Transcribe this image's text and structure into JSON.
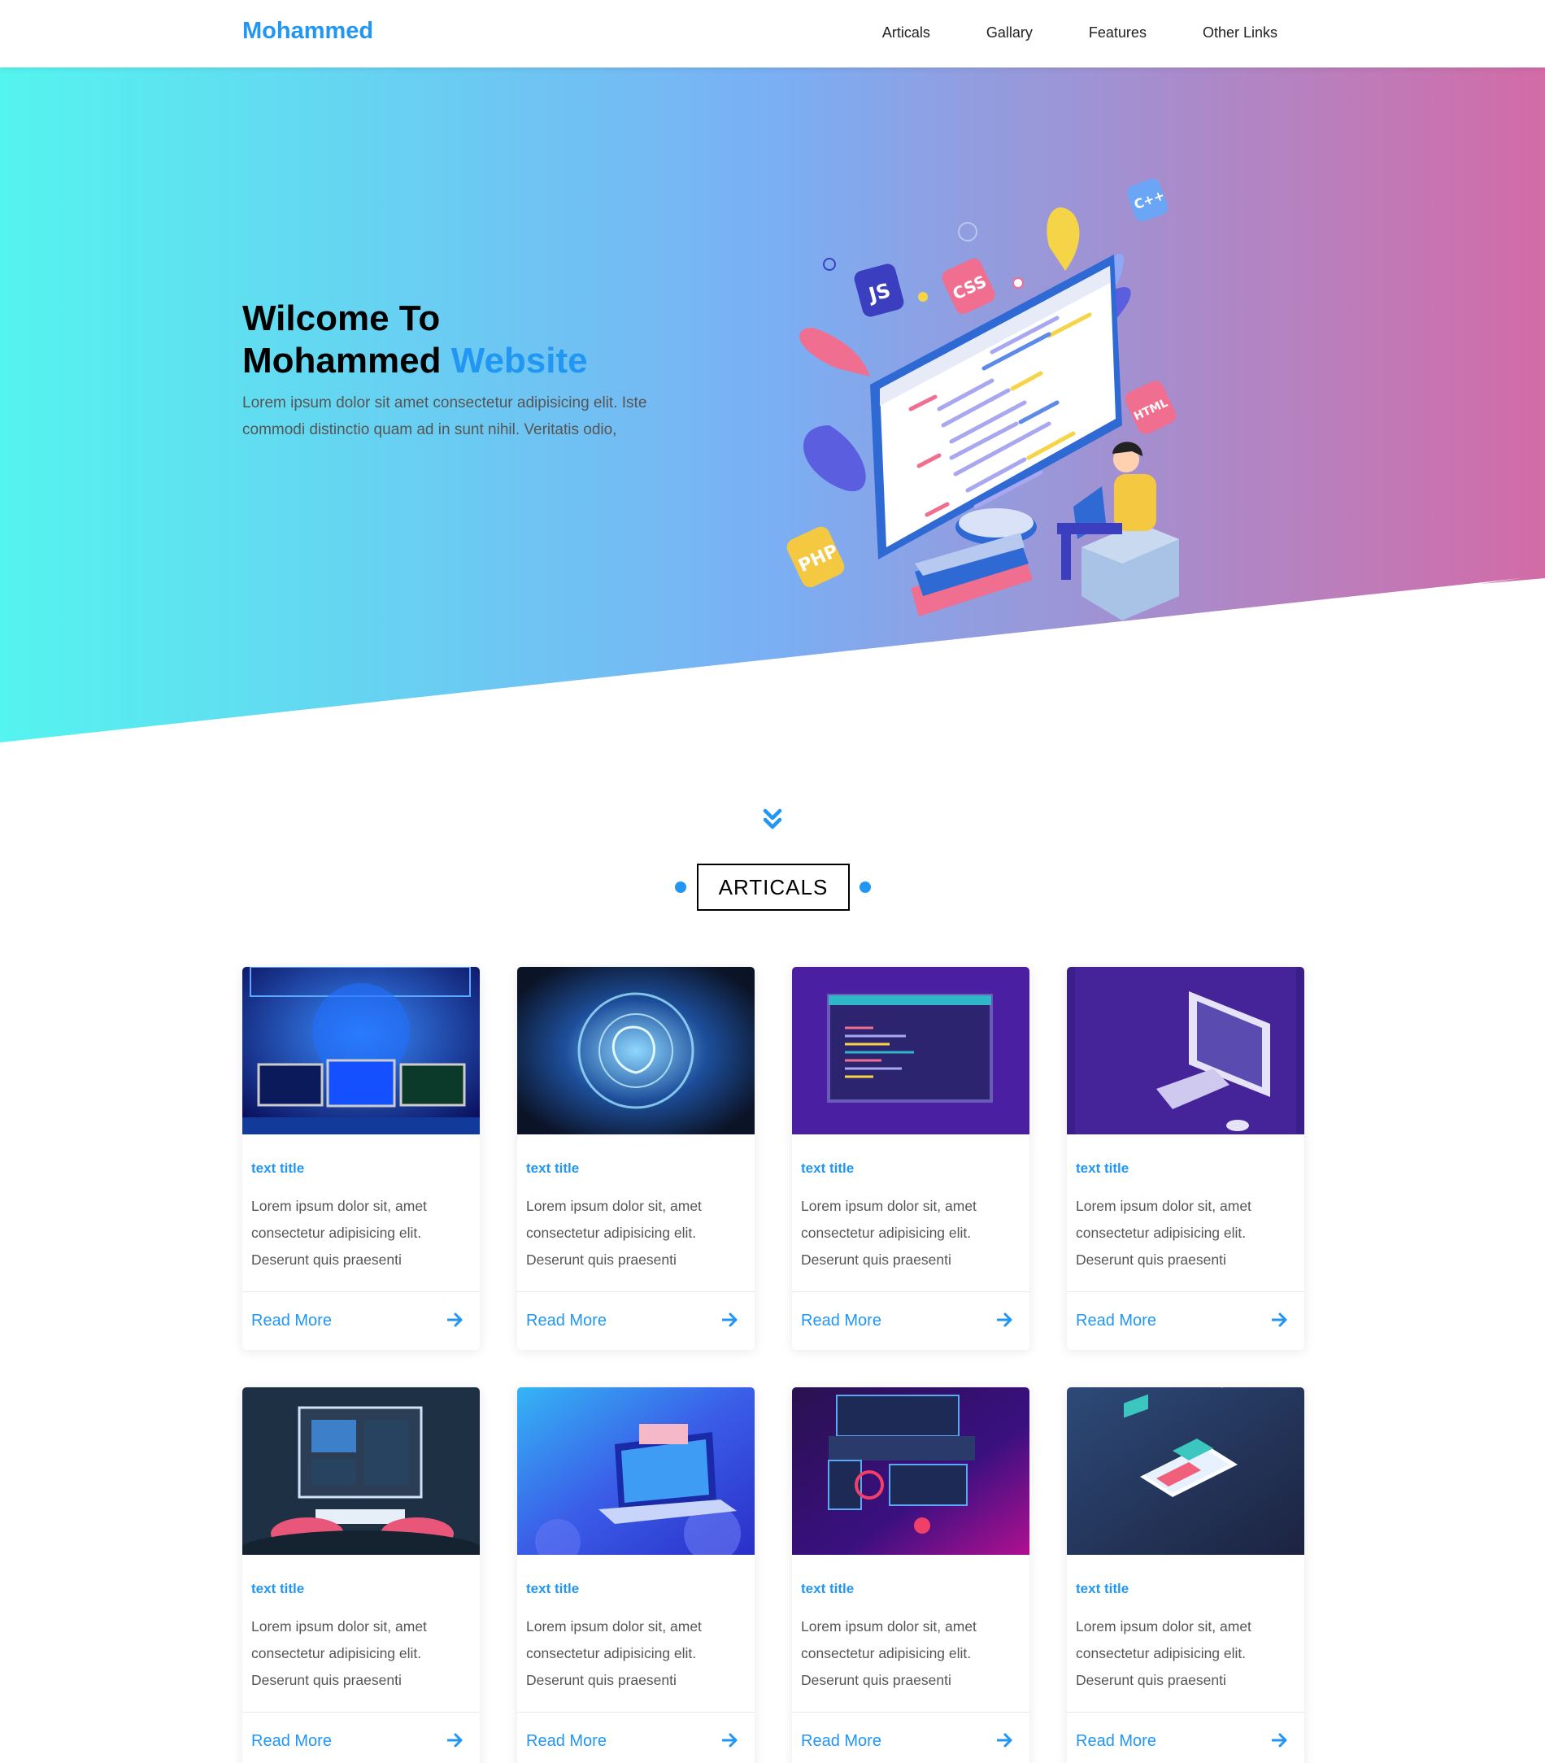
{
  "header": {
    "logo": "Mohammed",
    "nav": [
      "Articals",
      "Gallary",
      "Features",
      "Other Links"
    ]
  },
  "hero": {
    "title_line1": "Wilcome To",
    "title_line2_plain": "Mohammed",
    "title_line2_accent": "Website",
    "text": "Lorem ipsum dolor sit amet consectetur adipisicing elit. Iste commodi distinctio quam ad in sunt nihil. Veritatis odio,",
    "illustration_badges": [
      "JS",
      "CSS",
      "C++",
      "HTML",
      "PHP"
    ]
  },
  "articles": {
    "section_title": "ARTICALS",
    "cards": [
      {
        "title": "text title",
        "text": "Lorem ipsum dolor sit, amet consectetur adipisicing elit. Deserunt quis praesenti",
        "link": "Read More"
      },
      {
        "title": "text title",
        "text": "Lorem ipsum dolor sit, amet consectetur adipisicing elit. Deserunt quis praesenti",
        "link": "Read More"
      },
      {
        "title": "text title",
        "text": "Lorem ipsum dolor sit, amet consectetur adipisicing elit. Deserunt quis praesenti",
        "link": "Read More"
      },
      {
        "title": "text title",
        "text": "Lorem ipsum dolor sit, amet consectetur adipisicing elit. Deserunt quis praesenti",
        "link": "Read More"
      },
      {
        "title": "text title",
        "text": "Lorem ipsum dolor sit, amet consectetur adipisicing elit. Deserunt quis praesenti",
        "link": "Read More"
      },
      {
        "title": "text title",
        "text": "Lorem ipsum dolor sit, amet consectetur adipisicing elit. Deserunt quis praesenti",
        "link": "Read More"
      },
      {
        "title": "text title",
        "text": "Lorem ipsum dolor sit, amet consectetur adipisicing elit. Deserunt quis praesenti",
        "link": "Read More"
      },
      {
        "title": "text title",
        "text": "Lorem ipsum dolor sit, amet consectetur adipisicing elit. Deserunt quis praesenti",
        "link": "Read More"
      }
    ]
  },
  "colors": {
    "accent": "#2196f3",
    "gradient_start": "#54f4ef",
    "gradient_mid": "#7aaff4",
    "gradient_end": "#d36ba6"
  }
}
